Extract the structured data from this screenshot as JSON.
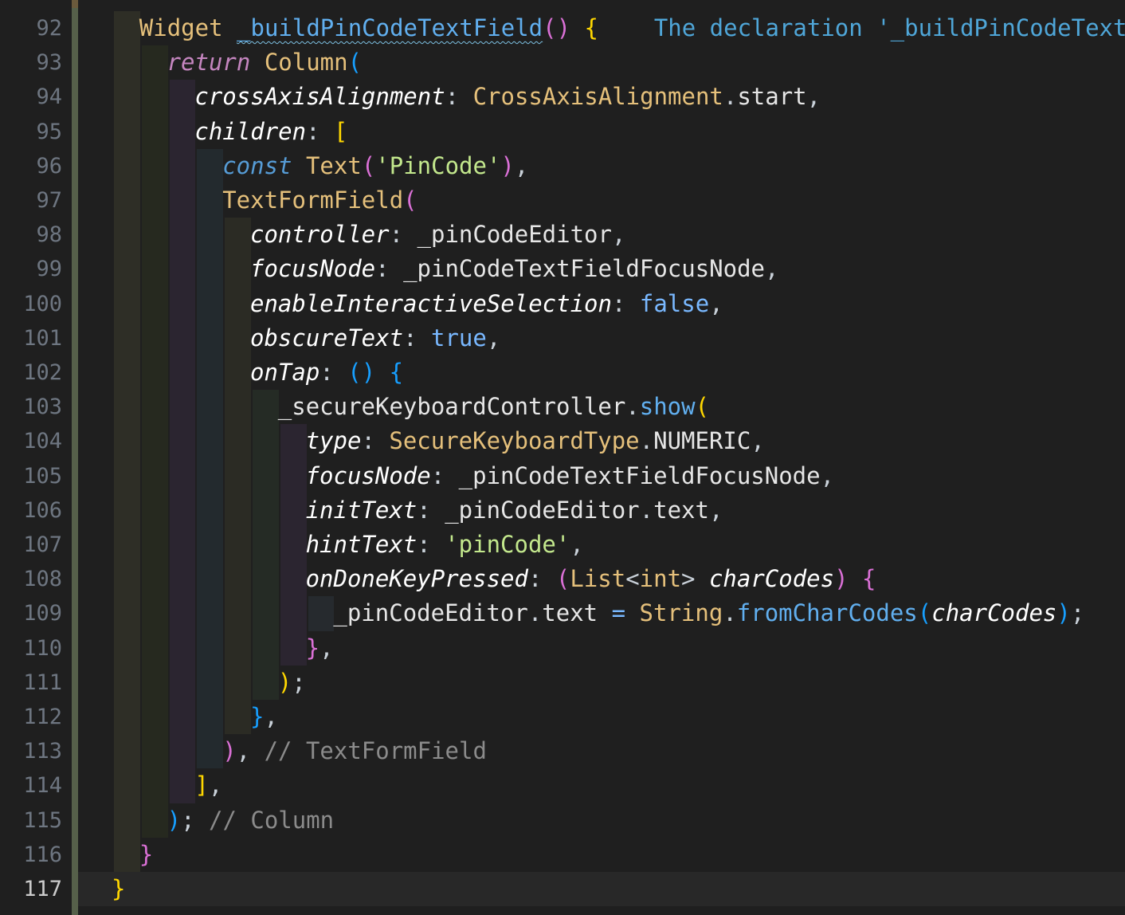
{
  "editor": {
    "theme": {
      "background": "#1f1f1f",
      "line_number": "#6e7681",
      "keyword": "#569cd6",
      "control": "#c586c0",
      "class": "#e5c07b",
      "function": "#61afef",
      "string": "#c3e88d",
      "comment": "#8b8b8b",
      "bracket_level_1": "#ffd700",
      "bracket_level_2": "#da70d6",
      "bracket_level_3": "#179fff"
    },
    "active_line": 117,
    "lines": [
      {
        "num": "92",
        "indent": 1,
        "tokens": [
          [
            "cls",
            "Widget"
          ],
          [
            "pun",
            " "
          ],
          [
            "fnw",
            "_buildPinCodeTextField"
          ],
          [
            "b2",
            "()"
          ],
          [
            "pun",
            " "
          ],
          [
            "b1",
            "{"
          ],
          [
            "hint",
            "    The declaration '_buildPinCodeTextF"
          ]
        ]
      },
      {
        "num": "93",
        "indent": 2,
        "tokens": [
          [
            "ctl it",
            "return"
          ],
          [
            "pun",
            " "
          ],
          [
            "cls",
            "Column"
          ],
          [
            "b3",
            "("
          ]
        ]
      },
      {
        "num": "94",
        "indent": 3,
        "tokens": [
          [
            "prm",
            "crossAxisAlignment"
          ],
          [
            "pun",
            ": "
          ],
          [
            "cls",
            "CrossAxisAlignment"
          ],
          [
            "pun",
            "."
          ],
          [
            "var",
            "start"
          ],
          [
            "pun",
            ","
          ]
        ]
      },
      {
        "num": "95",
        "indent": 3,
        "tokens": [
          [
            "prm",
            "children"
          ],
          [
            "pun",
            ": "
          ],
          [
            "b1",
            "["
          ]
        ]
      },
      {
        "num": "96",
        "indent": 4,
        "tokens": [
          [
            "kw it",
            "const"
          ],
          [
            "pun",
            " "
          ],
          [
            "cls",
            "Text"
          ],
          [
            "b2",
            "("
          ],
          [
            "str",
            "'PinCode'"
          ],
          [
            "b2",
            ")"
          ],
          [
            "pun",
            ","
          ]
        ]
      },
      {
        "num": "97",
        "indent": 4,
        "tokens": [
          [
            "cls",
            "TextFormField"
          ],
          [
            "b2",
            "("
          ]
        ]
      },
      {
        "num": "98",
        "indent": 5,
        "tokens": [
          [
            "prm",
            "controller"
          ],
          [
            "pun",
            ": "
          ],
          [
            "var",
            "_pinCodeEditor"
          ],
          [
            "pun",
            ","
          ]
        ]
      },
      {
        "num": "99",
        "indent": 5,
        "tokens": [
          [
            "prm",
            "focusNode"
          ],
          [
            "pun",
            ": "
          ],
          [
            "var",
            "_pinCodeTextFieldFocusNode"
          ],
          [
            "pun",
            ","
          ]
        ]
      },
      {
        "num": "100",
        "indent": 5,
        "tokens": [
          [
            "prm",
            "enableInteractiveSelection"
          ],
          [
            "pun",
            ": "
          ],
          [
            "lit",
            "false"
          ],
          [
            "pun",
            ","
          ]
        ]
      },
      {
        "num": "101",
        "indent": 5,
        "tokens": [
          [
            "prm",
            "obscureText"
          ],
          [
            "pun",
            ": "
          ],
          [
            "lit",
            "true"
          ],
          [
            "pun",
            ","
          ]
        ]
      },
      {
        "num": "102",
        "indent": 5,
        "tokens": [
          [
            "prm",
            "onTap"
          ],
          [
            "pun",
            ": "
          ],
          [
            "b3",
            "()"
          ],
          [
            "pun",
            " "
          ],
          [
            "b3",
            "{"
          ]
        ]
      },
      {
        "num": "103",
        "indent": 6,
        "tokens": [
          [
            "var",
            "_secureKeyboardController"
          ],
          [
            "pun",
            "."
          ],
          [
            "fn",
            "show"
          ],
          [
            "b1",
            "("
          ]
        ]
      },
      {
        "num": "104",
        "indent": 7,
        "tokens": [
          [
            "prm",
            "type"
          ],
          [
            "pun",
            ": "
          ],
          [
            "cls",
            "SecureKeyboardType"
          ],
          [
            "pun",
            "."
          ],
          [
            "var",
            "NUMERIC"
          ],
          [
            "pun",
            ","
          ]
        ]
      },
      {
        "num": "105",
        "indent": 7,
        "tokens": [
          [
            "prm",
            "focusNode"
          ],
          [
            "pun",
            ": "
          ],
          [
            "var",
            "_pinCodeTextFieldFocusNode"
          ],
          [
            "pun",
            ","
          ]
        ]
      },
      {
        "num": "106",
        "indent": 7,
        "tokens": [
          [
            "prm",
            "initText"
          ],
          [
            "pun",
            ": "
          ],
          [
            "var",
            "_pinCodeEditor"
          ],
          [
            "pun",
            "."
          ],
          [
            "var",
            "text"
          ],
          [
            "pun",
            ","
          ]
        ]
      },
      {
        "num": "107",
        "indent": 7,
        "tokens": [
          [
            "prm",
            "hintText"
          ],
          [
            "pun",
            ": "
          ],
          [
            "str",
            "'pinCode'"
          ],
          [
            "pun",
            ","
          ]
        ]
      },
      {
        "num": "108",
        "indent": 7,
        "tokens": [
          [
            "prm",
            "onDoneKeyPressed"
          ],
          [
            "pun",
            ": "
          ],
          [
            "b2",
            "("
          ],
          [
            "cls",
            "List"
          ],
          [
            "pun",
            "<"
          ],
          [
            "cls",
            "int"
          ],
          [
            "pun",
            "> "
          ],
          [
            "prm",
            "charCodes"
          ],
          [
            "b2",
            ")"
          ],
          [
            "pun",
            " "
          ],
          [
            "b2",
            "{"
          ]
        ]
      },
      {
        "num": "109",
        "indent": 8,
        "tokens": [
          [
            "var",
            "_pinCodeEditor"
          ],
          [
            "pun",
            "."
          ],
          [
            "var",
            "text"
          ],
          [
            "pun",
            " "
          ],
          [
            "lit",
            "="
          ],
          [
            "pun",
            " "
          ],
          [
            "cls",
            "String"
          ],
          [
            "pun",
            "."
          ],
          [
            "fn",
            "fromCharCodes"
          ],
          [
            "b3",
            "("
          ],
          [
            "prm",
            "charCodes"
          ],
          [
            "b3",
            ")"
          ],
          [
            "pun",
            ";"
          ]
        ]
      },
      {
        "num": "110",
        "indent": 7,
        "tokens": [
          [
            "b2",
            "}"
          ],
          [
            "pun",
            ","
          ]
        ]
      },
      {
        "num": "111",
        "indent": 6,
        "tokens": [
          [
            "b1",
            ")"
          ],
          [
            "pun",
            ";"
          ]
        ]
      },
      {
        "num": "112",
        "indent": 5,
        "tokens": [
          [
            "b3",
            "}"
          ],
          [
            "pun",
            ","
          ]
        ]
      },
      {
        "num": "113",
        "indent": 4,
        "tokens": [
          [
            "b2",
            ")"
          ],
          [
            "pun",
            ", "
          ],
          [
            "cmt",
            "// TextFormField"
          ]
        ]
      },
      {
        "num": "114",
        "indent": 3,
        "tokens": [
          [
            "b1",
            "]"
          ],
          [
            "pun",
            ","
          ]
        ]
      },
      {
        "num": "115",
        "indent": 2,
        "tokens": [
          [
            "b3",
            ")"
          ],
          [
            "pun",
            "; "
          ],
          [
            "cmt",
            "// Column"
          ]
        ]
      },
      {
        "num": "116",
        "indent": 1,
        "tokens": [
          [
            "b2",
            "}"
          ]
        ]
      },
      {
        "num": "117",
        "indent": 0,
        "tokens": [
          [
            "b1",
            "}"
          ]
        ]
      }
    ]
  }
}
